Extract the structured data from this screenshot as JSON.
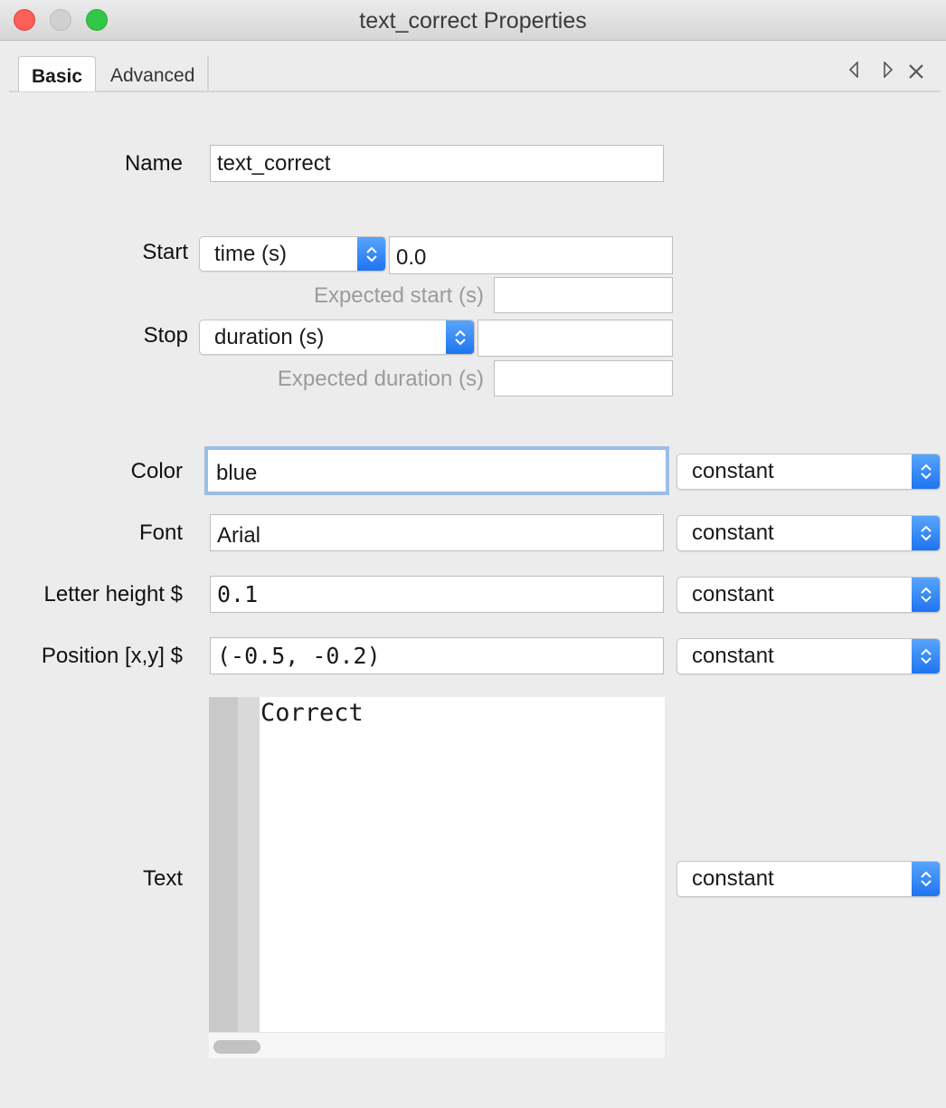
{
  "window": {
    "title": "text_correct Properties"
  },
  "tabs": [
    {
      "label": "Basic"
    },
    {
      "label": "Advanced"
    }
  ],
  "tabbar_icons": {
    "prev": "triangle-left-icon",
    "next": "triangle-right-icon",
    "close": "close-icon"
  },
  "name": {
    "label": "Name",
    "value": "text_correct"
  },
  "start": {
    "label": "Start",
    "type_value": "time (s)",
    "value": "0.0",
    "expected_label": "Expected start (s)",
    "expected_value": ""
  },
  "stop": {
    "label": "Stop",
    "type_value": "duration (s)",
    "value": "",
    "expected_label": "Expected duration (s)",
    "expected_value": ""
  },
  "color": {
    "label": "Color",
    "value": "blue",
    "update": "constant"
  },
  "font": {
    "label": "Font",
    "value": "Arial",
    "update": "constant"
  },
  "letter_height": {
    "label": "Letter height $",
    "value": "0.1",
    "update": "constant"
  },
  "position": {
    "label": "Position [x,y] $",
    "value": "(-0.5, -0.2)",
    "update": "constant"
  },
  "text": {
    "label": "Text",
    "value": "Correct",
    "update": "constant"
  },
  "colors": {
    "accent": "#1d73f0",
    "focus_ring": "#9bbde8"
  }
}
